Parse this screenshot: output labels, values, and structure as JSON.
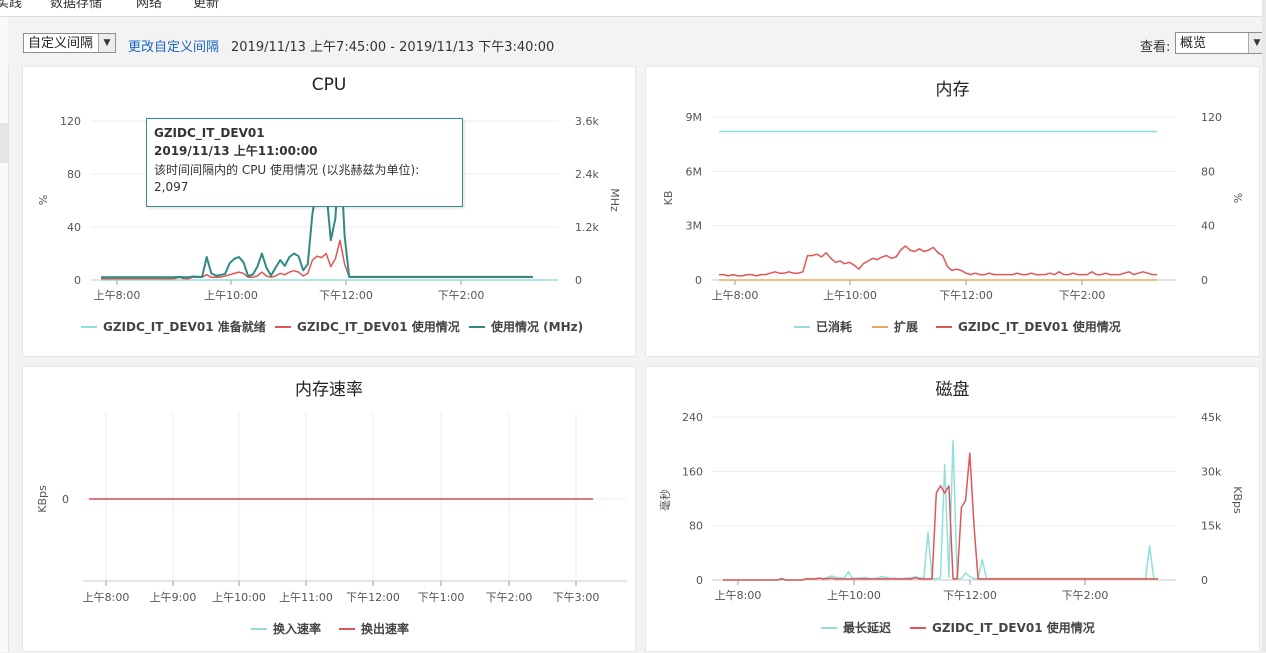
{
  "nav": {
    "tabs": [
      "实践",
      "数据存储",
      "网络",
      "更新"
    ]
  },
  "toolbar": {
    "interval_select": "自定义间隔",
    "change_interval_link": "更改自定义间隔",
    "range_text": "2019/11/13 上午7:45:00 - 2019/11/13 下午3:40:00",
    "view_label": "查看:",
    "view_select": "概览"
  },
  "colors": {
    "teal": "#2f8b82",
    "red": "#e05656",
    "light_teal": "#8fe0dc",
    "orange": "#f0a860",
    "link": "#1a66c4"
  },
  "panels": {
    "cpu": {
      "title": "CPU",
      "left_unit": "%",
      "right_unit": "MHz",
      "left_ticks": [
        "120",
        "80",
        "40",
        "0"
      ],
      "right_ticks": [
        "3.6k",
        "2.4k",
        "1.2k",
        "0"
      ],
      "x_ticks": [
        "上午8:00",
        "上午10:00",
        "下午12:00",
        "下午2:00"
      ],
      "legend": [
        "GZIDC_IT_DEV01 准备就绪",
        "GZIDC_IT_DEV01 使用情况",
        "使用情况 (MHz)"
      ],
      "tooltip": {
        "host": "GZIDC_IT_DEV01",
        "time": "2019/11/13 上午11:00:00",
        "desc": "该时间间隔内的 CPU 使用情况 (以兆赫兹为单位):",
        "value": "2,097"
      }
    },
    "memory": {
      "title": "内存",
      "left_unit": "KB",
      "right_unit": "%",
      "left_ticks": [
        "9M",
        "6M",
        "3M",
        "0"
      ],
      "right_ticks": [
        "120",
        "80",
        "40",
        "0"
      ],
      "x_ticks": [
        "上午8:00",
        "上午10:00",
        "下午12:00",
        "下午2:00"
      ],
      "legend": [
        "已消耗",
        "扩展",
        "GZIDC_IT_DEV01 使用情况"
      ]
    },
    "mem_rate": {
      "title": "内存速率",
      "left_unit": "KBps",
      "left_ticks": [
        "0"
      ],
      "x_ticks": [
        "上午8:00",
        "上午9:00",
        "上午10:00",
        "上午11:00",
        "下午12:00",
        "下午1:00",
        "下午2:00",
        "下午3:00"
      ],
      "legend": [
        "换入速率",
        "换出速率"
      ]
    },
    "disk": {
      "title": "磁盘",
      "left_unit": "毫秒",
      "right_unit": "KBps",
      "left_ticks": [
        "240",
        "160",
        "80",
        "0"
      ],
      "right_ticks": [
        "45k",
        "30k",
        "15k",
        "0"
      ],
      "x_ticks": [
        "上午8:00",
        "上午10:00",
        "下午12:00",
        "下午2:00"
      ],
      "legend": [
        "最长延迟",
        "GZIDC_IT_DEV01 使用情况"
      ]
    }
  },
  "chart_data": [
    {
      "type": "line",
      "title": "CPU",
      "x_range": [
        "上午7:45",
        "下午3:40"
      ],
      "series": [
        {
          "name": "GZIDC_IT_DEV01 准备就绪",
          "axis": "%",
          "values": [
            0,
            0,
            0,
            0,
            0,
            0,
            0,
            0,
            0,
            0,
            0,
            0,
            0,
            0,
            0,
            0,
            0,
            0,
            0,
            0,
            0,
            0,
            0,
            0,
            0,
            0,
            0,
            0,
            0,
            0,
            0,
            0,
            0,
            0,
            0,
            0,
            0,
            0,
            0,
            0,
            0,
            0,
            0,
            0,
            0,
            0,
            0,
            0,
            0,
            0,
            0,
            0,
            0,
            0,
            0,
            0,
            0,
            0,
            0,
            0,
            0,
            0,
            0,
            0,
            0,
            0,
            0,
            0,
            0,
            0,
            0,
            0,
            0,
            0,
            0,
            0,
            0,
            0,
            0,
            0,
            0,
            0,
            0,
            0,
            0,
            0,
            0,
            0,
            0,
            0,
            0,
            0,
            0,
            0,
            0
          ]
        },
        {
          "name": "GZIDC_IT_DEV01 使用情况",
          "axis": "%",
          "values": [
            1,
            1,
            1,
            1,
            1,
            1,
            1,
            1,
            1,
            1,
            1,
            1,
            1,
            1,
            1,
            1,
            1,
            2,
            1,
            1,
            2,
            2,
            2,
            4,
            2,
            2,
            2,
            3,
            4,
            5,
            6,
            5,
            2,
            2,
            3,
            6,
            3,
            2,
            3,
            5,
            4,
            6,
            7,
            6,
            3,
            5,
            15,
            18,
            17,
            20,
            10,
            16,
            30,
            12,
            2,
            2,
            2,
            2,
            2,
            2,
            2,
            2,
            2,
            2,
            2,
            2,
            2,
            2,
            2,
            2,
            2,
            2,
            2,
            2,
            2,
            2,
            2,
            2,
            2,
            2,
            2,
            2,
            2,
            2,
            2,
            2,
            2,
            2,
            2,
            2,
            2,
            2,
            2,
            2,
            2
          ]
        },
        {
          "name": "使用情况 (MHz)",
          "axis": "MHz",
          "values": [
            60,
            60,
            60,
            60,
            60,
            60,
            60,
            60,
            60,
            60,
            60,
            60,
            60,
            60,
            60,
            60,
            60,
            70,
            60,
            60,
            80,
            75,
            70,
            520,
            150,
            100,
            110,
            140,
            380,
            480,
            520,
            400,
            90,
            120,
            300,
            600,
            280,
            100,
            280,
            450,
            320,
            520,
            600,
            540,
            220,
            360,
            1500,
            2097,
            2400,
            2050,
            900,
            1400,
            3100,
            1000,
            70,
            70,
            70,
            70,
            70,
            70,
            70,
            70,
            70,
            70,
            70,
            70,
            70,
            70,
            70,
            70,
            70,
            70,
            70,
            70,
            70,
            70,
            70,
            70,
            70,
            70,
            70,
            70,
            70,
            70,
            70,
            70,
            70,
            70,
            70,
            70,
            70,
            70,
            70,
            70,
            70
          ]
        }
      ]
    },
    {
      "type": "line",
      "title": "内存",
      "series": [
        {
          "name": "已消耗",
          "axis": "KB",
          "values_note_free": true,
          "values": [
            8200000,
            8200000,
            8200000,
            8200000,
            8200000,
            8200000,
            8200000,
            8200000,
            8200000,
            8200000,
            8200000,
            8200000
          ]
        },
        {
          "name": "扩展",
          "axis": "KB",
          "values": [
            0,
            0,
            0,
            0,
            0,
            0,
            0,
            0,
            0,
            0,
            0,
            0
          ]
        },
        {
          "name": "GZIDC_IT_DEV01 使用情况",
          "axis": "%",
          "values": [
            4,
            4,
            3,
            4,
            3,
            3,
            4,
            4,
            3,
            4,
            4,
            5,
            6,
            5,
            5,
            6,
            5,
            5,
            6,
            18,
            18,
            19,
            17,
            20,
            16,
            13,
            14,
            12,
            13,
            11,
            8,
            12,
            14,
            16,
            15,
            17,
            18,
            16,
            17,
            22,
            25,
            22,
            21,
            23,
            21,
            22,
            24,
            20,
            18,
            10,
            7,
            8,
            7,
            5,
            4,
            5,
            4,
            4,
            5,
            4,
            4,
            4,
            4,
            4,
            5,
            4,
            4,
            5,
            4,
            4,
            4,
            5,
            4,
            6,
            4,
            4,
            5,
            4,
            4,
            4,
            6,
            4,
            4,
            5,
            4,
            4,
            4,
            5,
            6,
            4,
            5,
            6,
            5,
            4,
            4
          ]
        }
      ]
    },
    {
      "type": "line",
      "title": "内存速率",
      "series": [
        {
          "name": "换入速率",
          "values": [
            0,
            0
          ]
        },
        {
          "name": "换出速率",
          "values": [
            0,
            0
          ]
        }
      ]
    },
    {
      "type": "line",
      "title": "磁盘",
      "series": [
        {
          "name": "最长延迟",
          "axis": "毫秒",
          "values": [
            0,
            0,
            0,
            0,
            0,
            0,
            0,
            0,
            0,
            0,
            0,
            0,
            0,
            0,
            3,
            0,
            0,
            0,
            0,
            0,
            2,
            2,
            2,
            3,
            2,
            4,
            6,
            4,
            3,
            3,
            12,
            2,
            3,
            3,
            4,
            2,
            2,
            3,
            5,
            4,
            2,
            3,
            2,
            2,
            3,
            3,
            5,
            3,
            3,
            70,
            2,
            2,
            3,
            170,
            4,
            205,
            2,
            2,
            10,
            5,
            2,
            2,
            30,
            2,
            2,
            2,
            2,
            2,
            2,
            2,
            2,
            2,
            2,
            2,
            2,
            2,
            2,
            2,
            2,
            2,
            2,
            2,
            2,
            2,
            2,
            2,
            2,
            2,
            2,
            2,
            2,
            2,
            2,
            2,
            2,
            2,
            2,
            2,
            2,
            2,
            2,
            2,
            50,
            2,
            2
          ]
        },
        {
          "name": "GZIDC_IT_DEV01 使用情况",
          "axis": "KBps",
          "values": [
            0,
            0,
            0,
            0,
            0,
            0,
            0,
            0,
            0,
            0,
            0,
            0,
            0,
            0,
            300,
            0,
            0,
            0,
            0,
            0,
            400,
            300,
            300,
            500,
            300,
            400,
            500,
            300,
            300,
            300,
            300,
            300,
            300,
            300,
            300,
            300,
            300,
            300,
            300,
            300,
            300,
            300,
            300,
            300,
            300,
            300,
            600,
            300,
            300,
            300,
            300,
            24000,
            26000,
            24000,
            26000,
            300,
            300,
            20000,
            22000,
            35000,
            15000,
            300,
            300,
            300,
            300,
            300,
            300,
            300,
            300,
            300,
            300,
            300,
            300,
            300,
            300,
            300,
            300,
            300,
            300,
            300,
            300,
            300,
            300,
            300,
            300,
            300,
            300,
            300,
            300,
            300,
            300,
            300,
            300,
            300,
            300,
            300,
            300,
            300,
            300,
            300,
            300,
            300,
            300,
            300,
            300
          ]
        }
      ]
    }
  ]
}
